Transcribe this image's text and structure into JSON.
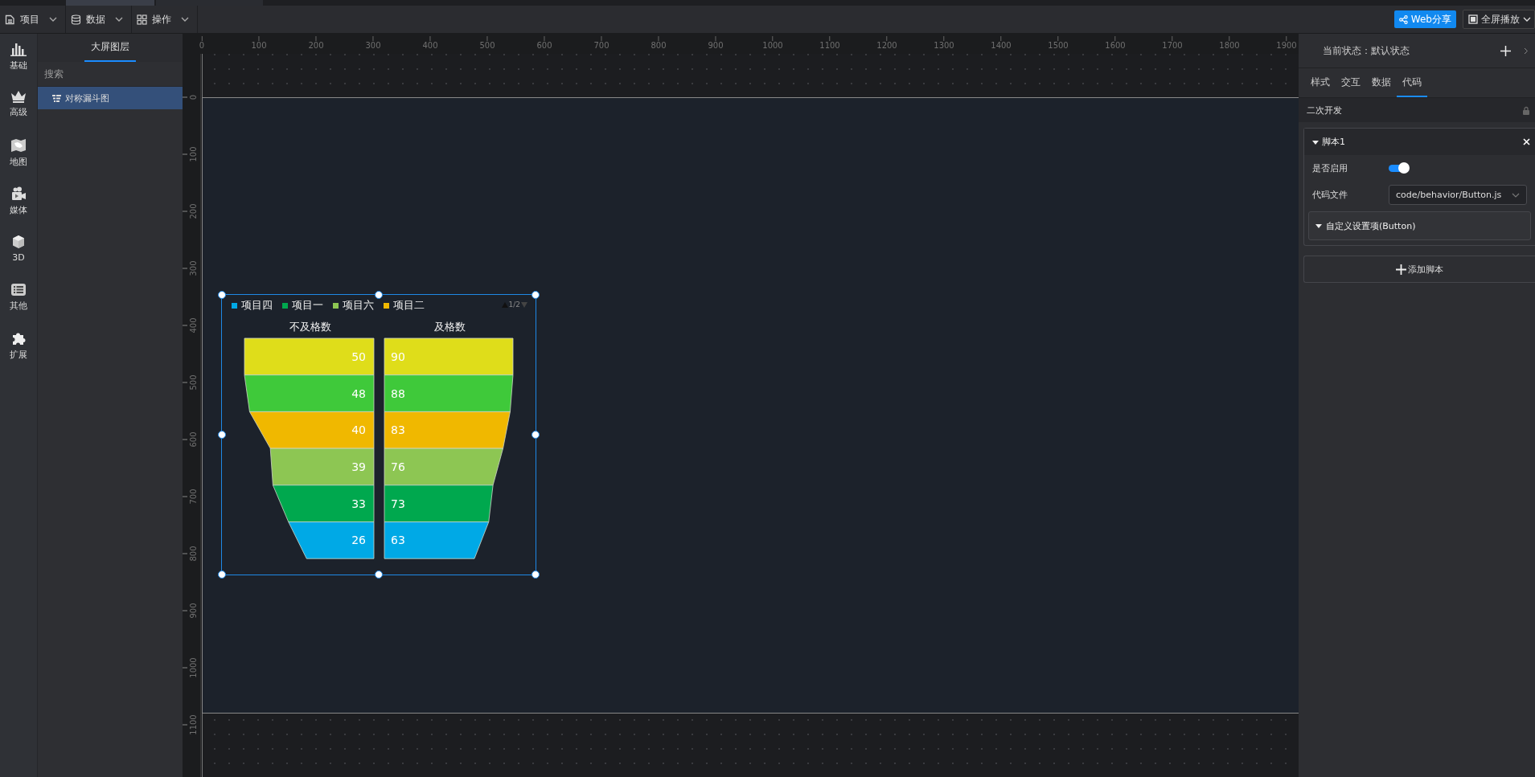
{
  "toolbar": {
    "menus": [
      {
        "label": "项目"
      },
      {
        "label": "数据"
      },
      {
        "label": "操作"
      }
    ],
    "share_button": "Web分享",
    "fullscreen_button": "全屏播放"
  },
  "sidebar": {
    "items": [
      {
        "label": "基础"
      },
      {
        "label": "高级"
      },
      {
        "label": "地图"
      },
      {
        "label": "媒体"
      },
      {
        "label": "3D"
      },
      {
        "label": "其他"
      },
      {
        "label": "扩展"
      }
    ]
  },
  "layers": {
    "tabs": [
      {
        "label": "大屏图层",
        "selected": true
      }
    ],
    "search": {
      "placeholder": "搜索"
    },
    "items": [
      {
        "label": "对称漏斗图",
        "selected": true
      }
    ]
  },
  "ruler": {
    "x_labels": [
      "0",
      "100",
      "200",
      "300",
      "400",
      "500",
      "600",
      "700",
      "800",
      "900",
      "1000",
      "1100",
      "1200",
      "1300",
      "1400",
      "1500",
      "1600",
      "1700",
      "1800",
      "1900"
    ],
    "y_labels": [
      "0",
      "100",
      "200",
      "300",
      "400",
      "500",
      "600",
      "700",
      "800",
      "900",
      "1000",
      "1100"
    ]
  },
  "widget": {
    "selected": true,
    "legend": [
      {
        "label": "项目四",
        "color": "#00a9e6"
      },
      {
        "label": "项目一",
        "color": "#00a84e"
      },
      {
        "label": "项目六",
        "color": "#8dc653"
      },
      {
        "label": "项目二",
        "color": "#f0b800"
      }
    ],
    "pager": "1/2",
    "funnels": [
      {
        "title": "不及格数",
        "segments": [
          {
            "value": "50",
            "color": "#dfdd1a"
          },
          {
            "value": "48",
            "color": "#3fc93a"
          },
          {
            "value": "40",
            "color": "#f0b800"
          },
          {
            "value": "39",
            "color": "#8dc653"
          },
          {
            "value": "33",
            "color": "#00a84e"
          },
          {
            "value": "26",
            "color": "#00a9e6"
          }
        ]
      },
      {
        "title": "及格数",
        "segments": [
          {
            "value": "90",
            "color": "#dfdd1a"
          },
          {
            "value": "88",
            "color": "#3fc93a"
          },
          {
            "value": "83",
            "color": "#f0b800"
          },
          {
            "value": "76",
            "color": "#8dc653"
          },
          {
            "value": "73",
            "color": "#00a84e"
          },
          {
            "value": "63",
            "color": "#00a9e6"
          }
        ]
      }
    ]
  },
  "panel": {
    "state_label": "当前状态：默认状态",
    "tabs": [
      {
        "label": "样式",
        "selected": false
      },
      {
        "label": "交互",
        "selected": false
      },
      {
        "label": "数据",
        "selected": false
      },
      {
        "label": "代码",
        "selected": true
      }
    ],
    "section": "二次开发",
    "script": {
      "title": "脚本1",
      "expanded": true,
      "enabled_label": "是否启用",
      "enabled": true,
      "file_label": "代码文件",
      "file": "code/behavior/Button.js",
      "custom": {
        "label": "自定义设置项(Button)",
        "expanded": true
      }
    },
    "add_button": "添加脚本"
  }
}
